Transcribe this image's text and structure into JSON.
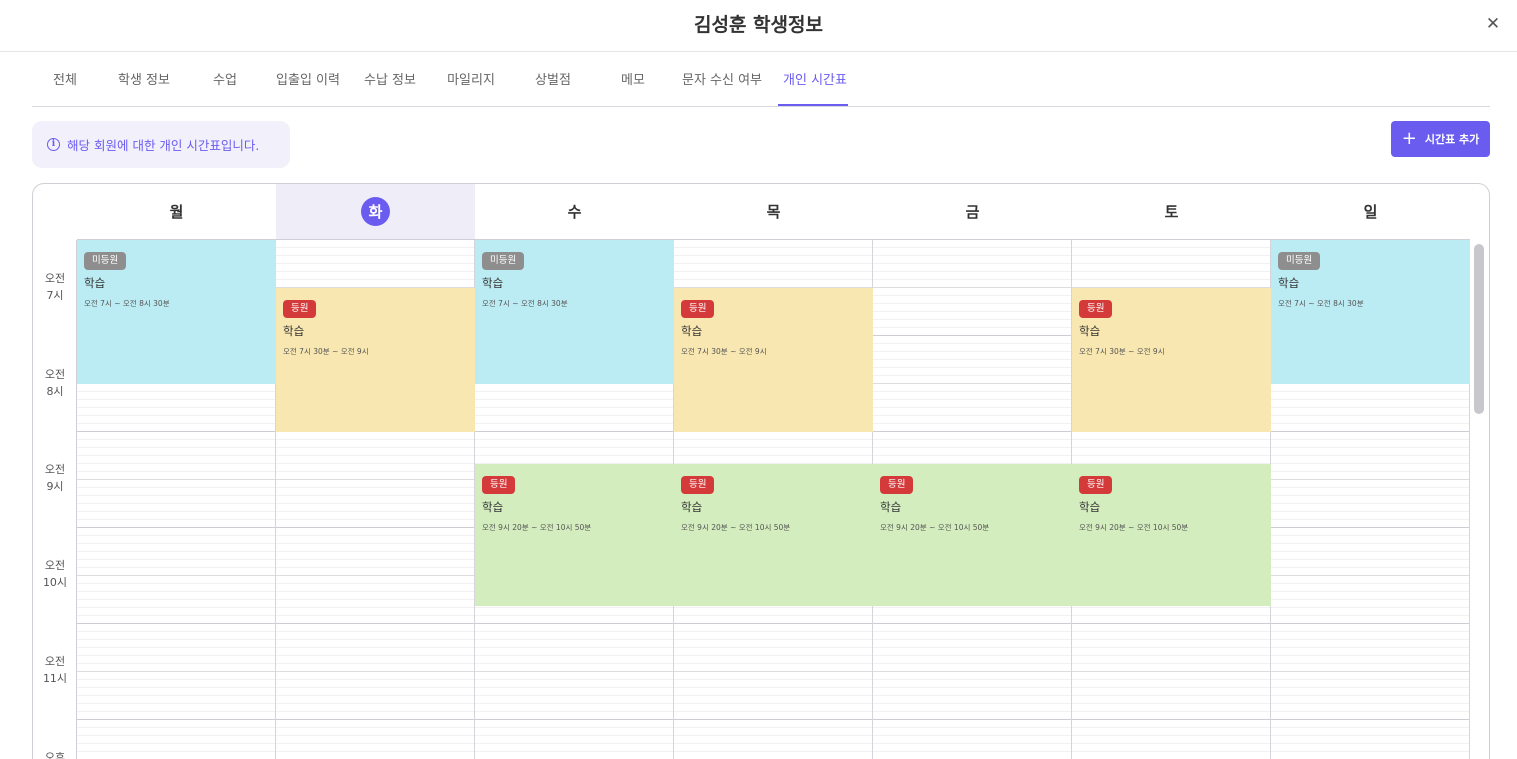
{
  "modal": {
    "title": "김성훈 학생정보",
    "close_glyph": "✕"
  },
  "tabs": [
    {
      "label": "전체"
    },
    {
      "label": "학생 정보"
    },
    {
      "label": "수업"
    },
    {
      "label": "입출입 이력"
    },
    {
      "label": "수납 정보"
    },
    {
      "label": "마일리지"
    },
    {
      "label": "상벌점"
    },
    {
      "label": "메모"
    },
    {
      "label": "문자 수신 여부"
    },
    {
      "label": "개인 시간표"
    }
  ],
  "active_tab": "개인 시간표",
  "info": {
    "icon": "info-icon",
    "text": "해당 회원에 대한 개인 시간표입니다."
  },
  "add_button": {
    "icon": "plus-icon",
    "label": "시간표 추가"
  },
  "calendar": {
    "days": [
      "월",
      "화",
      "수",
      "목",
      "금",
      "토",
      "일"
    ],
    "today": "화",
    "time_labels": [
      {
        "ampm": "오전",
        "hour": "7시"
      },
      {
        "ampm": "오전",
        "hour": "8시"
      },
      {
        "ampm": "오전",
        "hour": "9시"
      },
      {
        "ampm": "오전",
        "hour": "10시"
      },
      {
        "ampm": "오전",
        "hour": "11시"
      },
      {
        "ampm": "오후",
        "hour": ""
      }
    ],
    "events": [
      {
        "day": 0,
        "badge": "미등원",
        "status": "absent",
        "title": "학습",
        "time": "오전 7시 ~ 오전 8시 30분",
        "color": "#bcecf3"
      },
      {
        "day": 1,
        "badge": "등원",
        "status": "present",
        "title": "학습",
        "time": "오전 7시 30분 ~ 오전 9시",
        "color": "#f8e7b0"
      },
      {
        "day": 2,
        "badge": "미등원",
        "status": "absent",
        "title": "학습",
        "time": "오전 7시 ~ 오전 8시 30분",
        "color": "#bcecf3"
      },
      {
        "day": 3,
        "badge": "등원",
        "status": "present",
        "title": "학습",
        "time": "오전 7시 30분 ~ 오전 9시",
        "color": "#f8e7b0"
      },
      {
        "day": 5,
        "badge": "등원",
        "status": "present",
        "title": "학습",
        "time": "오전 7시 30분 ~ 오전 9시",
        "color": "#f8e7b0"
      },
      {
        "day": 6,
        "badge": "미등원",
        "status": "absent",
        "title": "학습",
        "time": "오전 7시 ~ 오전 8시 30분",
        "color": "#bcecf3"
      },
      {
        "day": 2,
        "badge": "등원",
        "status": "present",
        "title": "학습",
        "time": "오전 9시 20분 ~ 오전 10시 50분",
        "color": "#d3edbe"
      },
      {
        "day": 3,
        "badge": "등원",
        "status": "present",
        "title": "학습",
        "time": "오전 9시 20분 ~ 오전 10시 50분",
        "color": "#d3edbe"
      },
      {
        "day": 4,
        "badge": "등원",
        "status": "present",
        "title": "학습",
        "time": "오전 9시 20분 ~ 오전 10시 50분",
        "color": "#d3edbe"
      },
      {
        "day": 5,
        "badge": "등원",
        "status": "present",
        "title": "학습",
        "time": "오전 9시 20분 ~ 오전 10시 50분",
        "color": "#d3edbe"
      }
    ]
  },
  "colors": {
    "accent": "#6b5cf0",
    "present_badge": "#d43a3a",
    "absent_badge": "#8e8e8e"
  }
}
